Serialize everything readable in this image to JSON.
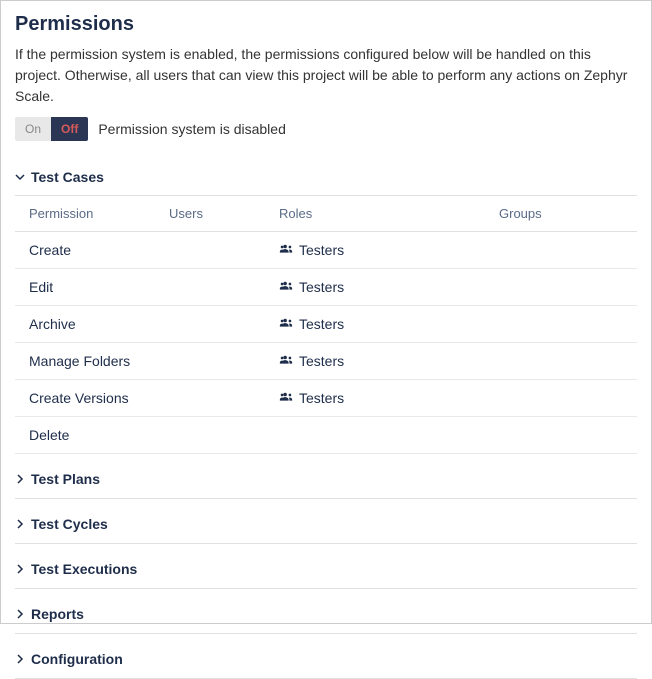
{
  "title": "Permissions",
  "description": "If the permission system is enabled, the permissions configured below will be handled on this project. Otherwise, all users that can view this project will be able to perform any actions on Zephyr Scale.",
  "toggle": {
    "on_label": "On",
    "off_label": "Off",
    "status_text": "Permission system is disabled"
  },
  "expanded_section": {
    "title": "Test Cases",
    "columns": {
      "permission": "Permission",
      "users": "Users",
      "roles": "Roles",
      "groups": "Groups"
    },
    "rows": [
      {
        "permission": "Create",
        "users": "",
        "roles": "Testers",
        "groups": ""
      },
      {
        "permission": "Edit",
        "users": "",
        "roles": "Testers",
        "groups": ""
      },
      {
        "permission": "Archive",
        "users": "",
        "roles": "Testers",
        "groups": ""
      },
      {
        "permission": "Manage Folders",
        "users": "",
        "roles": "Testers",
        "groups": ""
      },
      {
        "permission": "Create Versions",
        "users": "",
        "roles": "Testers",
        "groups": ""
      },
      {
        "permission": "Delete",
        "users": "",
        "roles": "",
        "groups": ""
      }
    ]
  },
  "collapsed_sections": [
    {
      "title": "Test Plans"
    },
    {
      "title": "Test Cycles"
    },
    {
      "title": "Test Executions"
    },
    {
      "title": "Reports"
    },
    {
      "title": "Configuration"
    }
  ]
}
